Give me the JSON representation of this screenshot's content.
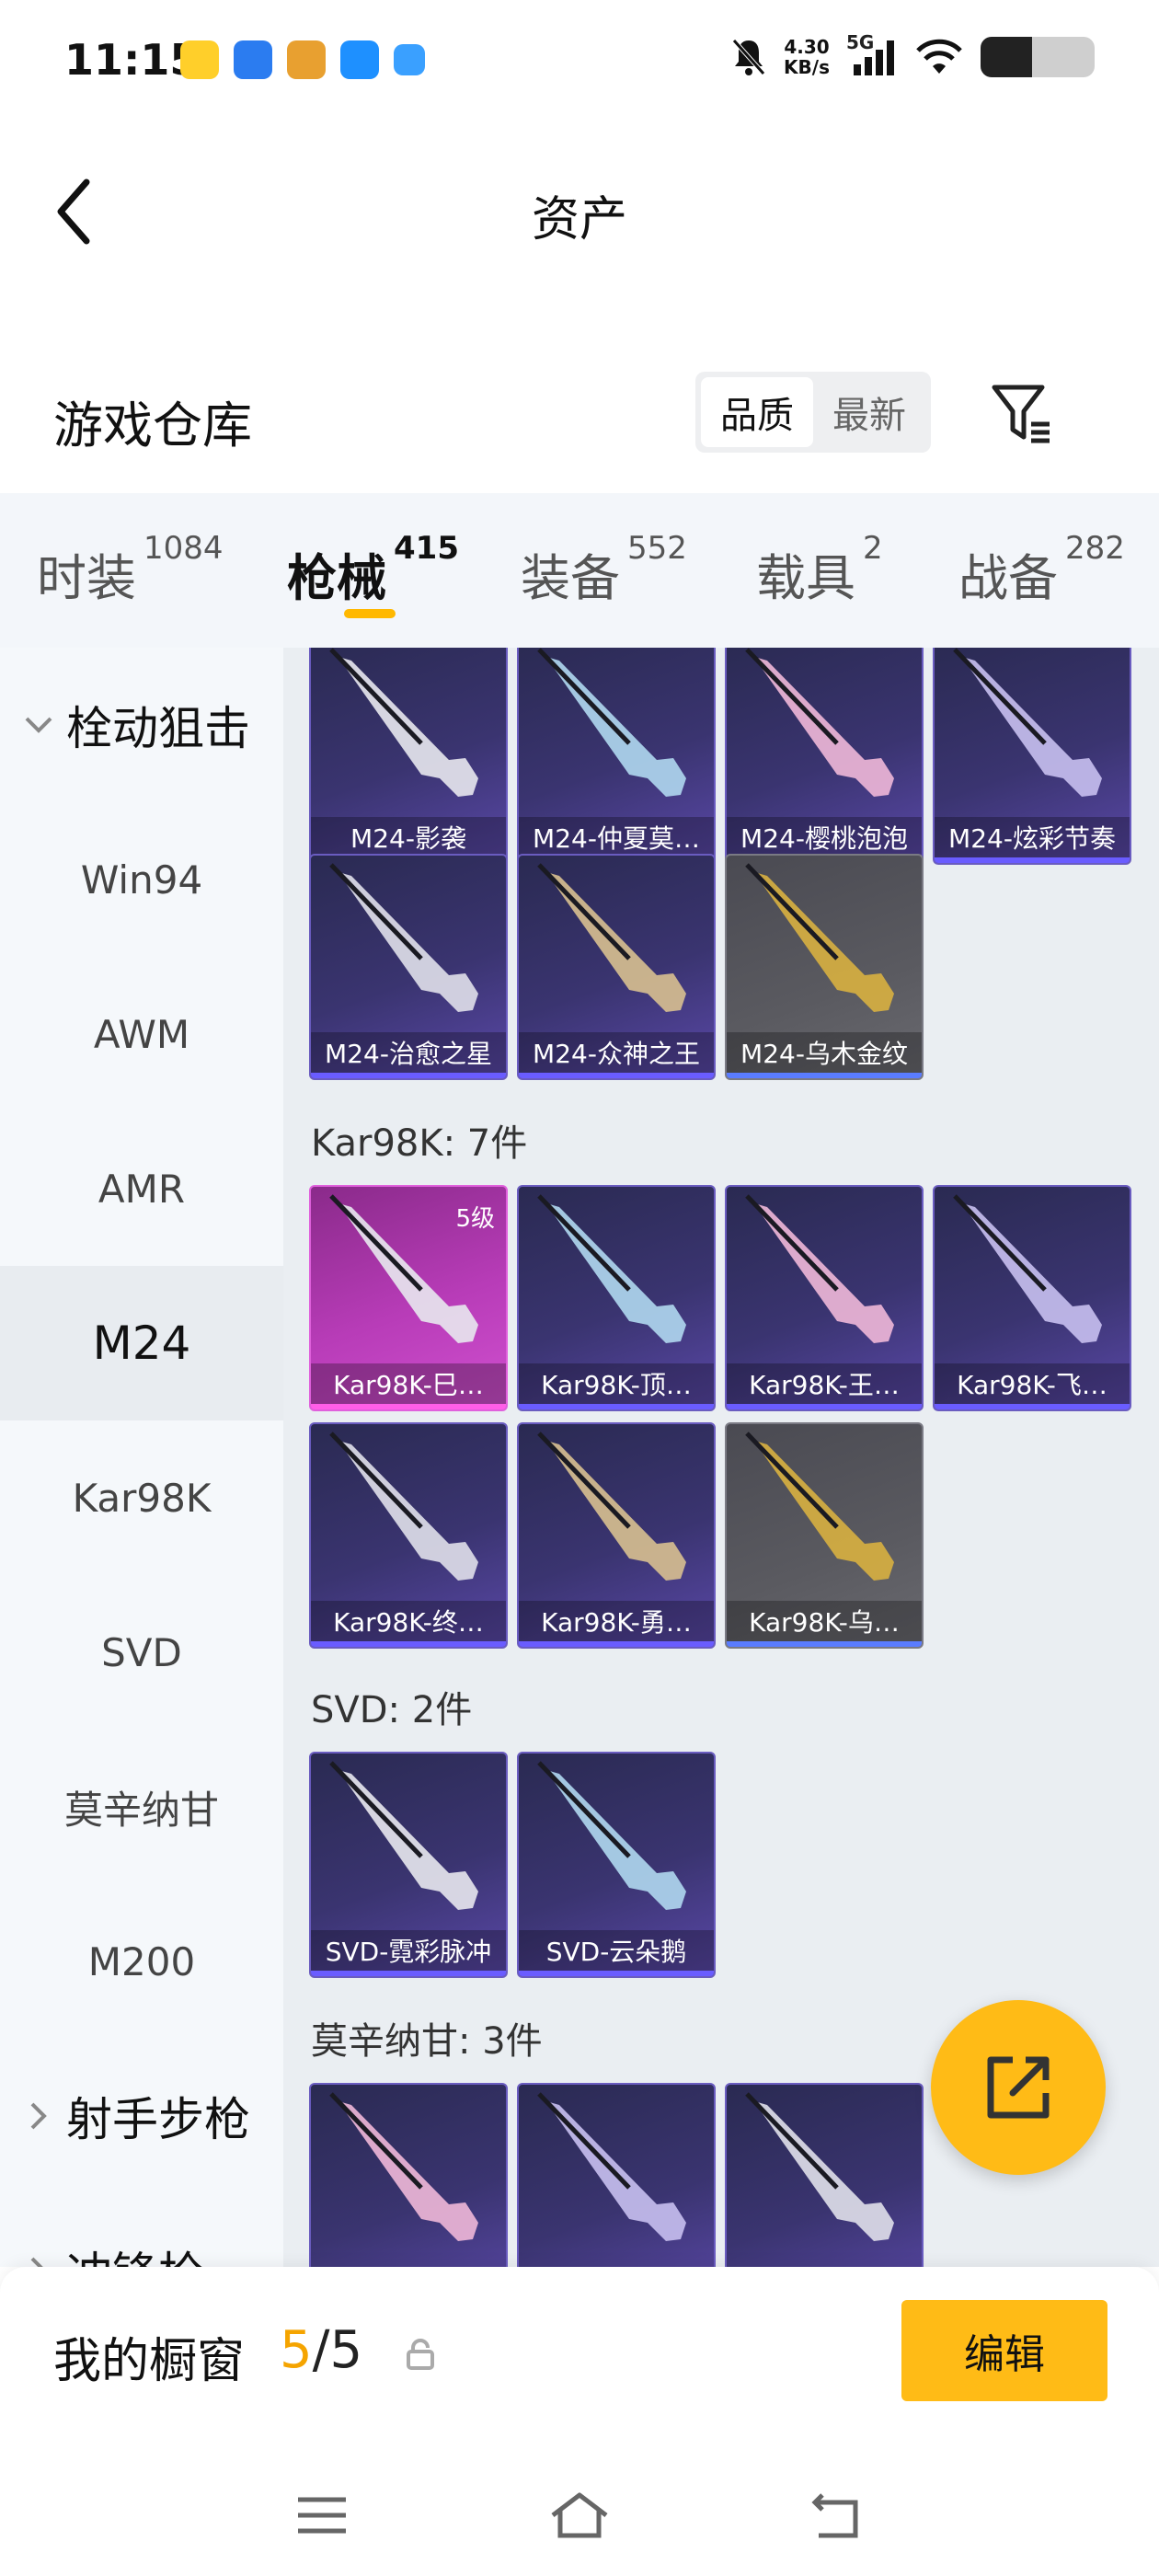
{
  "status_bar": {
    "time": "11:15",
    "net_speed_value": "4.30",
    "net_speed_unit": "KB/s",
    "signal": "5G",
    "battery_percent": 0.45
  },
  "header": {
    "title": "资产",
    "back_icon": "chevron-left-icon"
  },
  "warehouse": {
    "title": "游戏仓库",
    "sort_options": [
      "品质",
      "最新"
    ],
    "sort_active": "品质",
    "filter_icon": "filter-icon"
  },
  "tabs": [
    {
      "label": "时装",
      "count": "1084"
    },
    {
      "label": "枪械",
      "count": "415"
    },
    {
      "label": "装备",
      "count": "552"
    },
    {
      "label": "载具",
      "count": "2"
    },
    {
      "label": "战备",
      "count": "282"
    }
  ],
  "active_tab": "枪械",
  "sidebar": {
    "group_open": "栓动狙击",
    "items": [
      "Win94",
      "AWM",
      "AMR",
      "M24",
      "Kar98K",
      "SVD",
      "莫辛纳甘",
      "M200"
    ],
    "active": "M24",
    "group_collapsed": "射手步枪",
    "group_partial": "冲锋枪"
  },
  "content": {
    "m24_items": [
      "M24-影袭",
      "M24-仲夏莫…",
      "M24-樱桃泡泡",
      "M24-炫彩节奏",
      "M24-治愈之星",
      "M24-众神之王",
      "M24-乌木金纹"
    ],
    "kar98k_header": "Kar98K: 7件",
    "kar98k_items": [
      "Kar98K-巳…",
      "Kar98K-顶…",
      "Kar98K-王…",
      "Kar98K-飞…",
      "Kar98K-终…",
      "Kar98K-勇…",
      "Kar98K-乌…"
    ],
    "kar98k_level": "5级",
    "svd_header": "SVD: 2件",
    "svd_items": [
      "SVD-霓彩脉冲",
      "SVD-云朵鹅"
    ],
    "mosin_header": "莫辛纳甘: 3件"
  },
  "fab_icon": "share-export-icon",
  "bottom": {
    "window_label": "我的橱窗",
    "count_current": "5",
    "count_total": "/5",
    "edit_label": "编辑",
    "lock_icon": "lock-icon"
  },
  "nav": {
    "menu_icon": "menu-icon",
    "home_icon": "home-icon",
    "back_icon": "back-icon"
  },
  "colors": {
    "accent": "#ffbb16",
    "count_highlight": "#f5a400",
    "card_purple": "#3a3470",
    "card_pink": "#b83cb8"
  }
}
